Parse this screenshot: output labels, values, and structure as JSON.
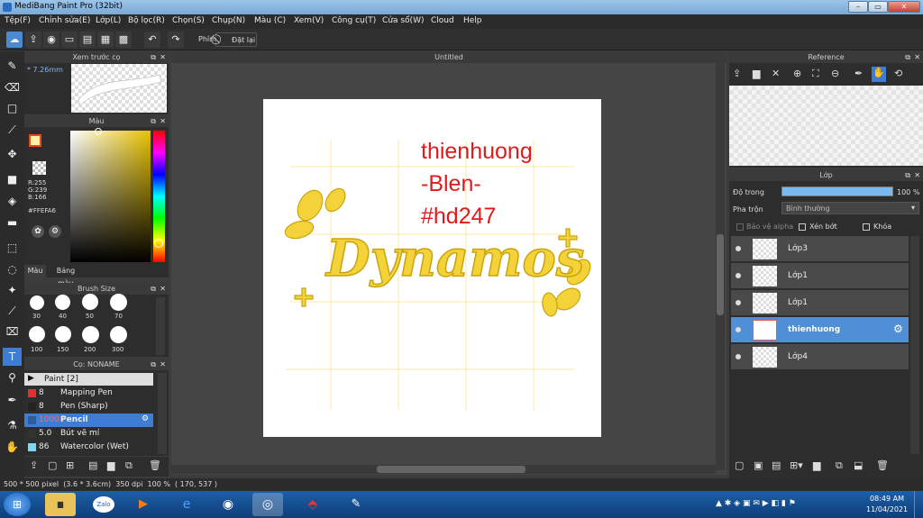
{
  "window": {
    "title": "MediBang Paint Pro (32bit)",
    "min": "–",
    "max": "▭",
    "close": "✕"
  },
  "menu": [
    "Tệp(F)",
    "Chỉnh sửa(E)",
    "Lớp(L)",
    "Bộ lọc(R)",
    "Chọn(S)",
    "Chụp(N)",
    "Màu (C)",
    "Xem(V)",
    "Công cụ(T)",
    "Cửa sổ(W)",
    "Cloud",
    "Help"
  ],
  "toolbar": {
    "key_label": "Phím",
    "reset_label": "Đặt lại"
  },
  "preview": {
    "title": "Xem trước cọ",
    "size": "* 7.26mm"
  },
  "color": {
    "title": "Màu",
    "r": "R:255",
    "g": "G:239",
    "b": "B:166",
    "hex": "#FFEFA6",
    "tab_color": "Màu",
    "tab_palette": "Bảng màu",
    "accent": "#ffefa6"
  },
  "brush_size": {
    "title": "Brush Size",
    "row1": [
      "30",
      "40",
      "50",
      "70"
    ],
    "row2": [
      "100",
      "150",
      "200",
      "300"
    ]
  },
  "brush": {
    "title": "Cọ: NONAME",
    "group": "Paint [2]",
    "items": [
      {
        "size": "8",
        "name": "Mapping Pen",
        "color": "#e03030"
      },
      {
        "size": "8",
        "name": "Pen (Sharp)",
        "color": "#222222"
      },
      {
        "size": "1000",
        "name": "Pencil",
        "color": "#2a5f9a"
      },
      {
        "size": "5.0",
        "name": "Bút vẽ mí",
        "color": "#333333"
      },
      {
        "size": "86",
        "name": "Watercolor (Wet)",
        "color": "#7fd6f0"
      }
    ]
  },
  "canvas": {
    "tab": "Untitled",
    "text1": "thienhuong",
    "text2": "-Blen-",
    "text3": "#hd247",
    "art": "Dynamos"
  },
  "reference": {
    "title": "Reference"
  },
  "layers": {
    "title": "Lớp",
    "opacity_label": "Độ trong",
    "opacity_value": "100 %",
    "opacity": 1.0,
    "blend_label": "Pha trộn",
    "blend_value": "Bình thường",
    "protect_alpha": "Bảo vệ alpha",
    "clipping": "Xén bớt",
    "lock": "Khóa",
    "items": [
      "Lớp3",
      "Lớp1",
      "Lớp1",
      "thienhuong",
      "Lớp4"
    ]
  },
  "status": {
    "text": "500 * 500 pixel  (3.6 * 3.6cm)  350 dpi  100 %  ( 170, 537 )"
  },
  "taskbar": {
    "zalo": "Zalo",
    "time": "08:49 AM",
    "date": "11/04/2021"
  }
}
